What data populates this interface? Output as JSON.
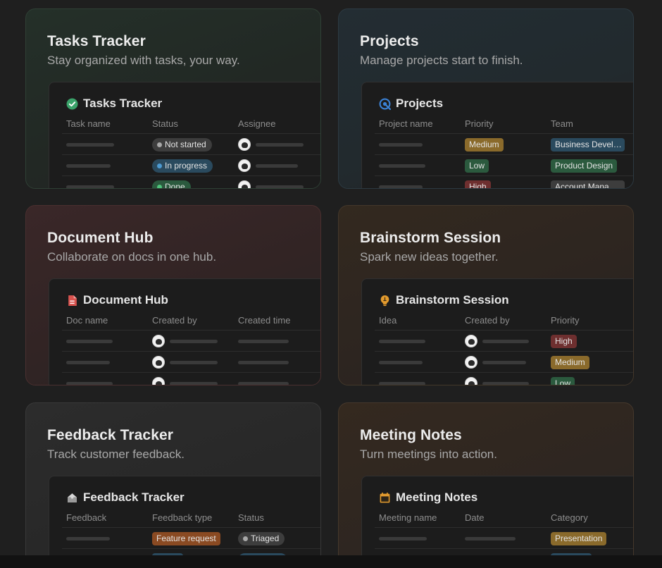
{
  "colors": {
    "page_bg": "#1f1f1f",
    "pill_gray": "#3d3d3d",
    "pill_blue": "#2a4a5e",
    "pill_green": "#2b5a3e",
    "pill_orange": "#8a5a2b",
    "pill_red": "#6e2f2f",
    "pill_yellow": "#8a6a2b"
  },
  "cards": [
    {
      "title": "Tasks Tracker",
      "subtitle": "Stay organized with tasks, your way.",
      "preview_title": "Tasks Tracker",
      "icon": "check-circle-icon",
      "columns": [
        "Task name",
        "Status",
        "Assignee"
      ],
      "cells": [
        "Not started",
        "In progress",
        "Done"
      ]
    },
    {
      "title": "Projects",
      "subtitle": "Manage projects start to finish.",
      "preview_title": "Projects",
      "icon": "target-icon",
      "columns": [
        "Project name",
        "Priority",
        "Team"
      ],
      "cells": [
        "Medium",
        "Low",
        "High",
        "Business Devel…",
        "Product Design",
        "Account Mana"
      ]
    },
    {
      "title": "Document Hub",
      "subtitle": "Collaborate on docs in one hub.",
      "preview_title": "Document Hub",
      "icon": "document-icon",
      "columns": [
        "Doc name",
        "Created by",
        "Created time"
      ]
    },
    {
      "title": "Brainstorm Session",
      "subtitle": "Spark new ideas together.",
      "preview_title": "Brainstorm Session",
      "icon": "lightbulb-icon",
      "columns": [
        "Idea",
        "Created by",
        "Priority"
      ],
      "cells": [
        "High",
        "Medium",
        "Low"
      ]
    },
    {
      "title": "Feedback Tracker",
      "subtitle": "Track customer feedback.",
      "preview_title": "Feedback Tracker",
      "icon": "inbox-icon",
      "columns": [
        "Feedback",
        "Feedback type",
        "Status"
      ],
      "cells": [
        "Feature request",
        "Triaged"
      ]
    },
    {
      "title": "Meeting Notes",
      "subtitle": "Turn meetings into action.",
      "preview_title": "Meeting Notes",
      "icon": "calendar-icon",
      "columns": [
        "Meeting name",
        "Date",
        "Category"
      ],
      "cells": [
        "Presentation"
      ]
    }
  ]
}
